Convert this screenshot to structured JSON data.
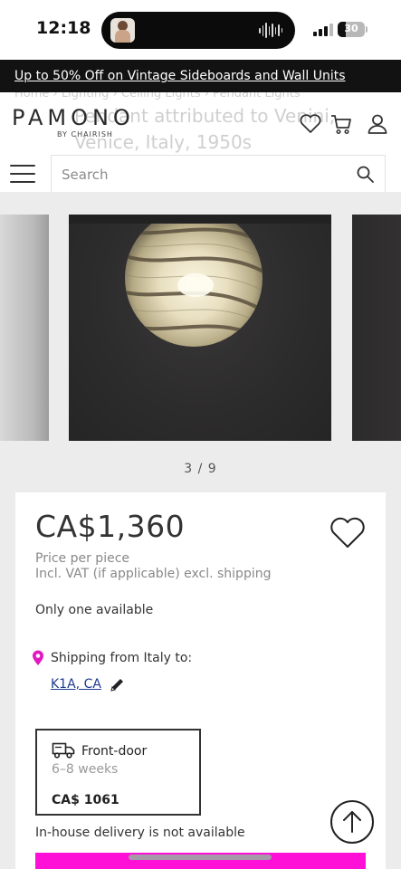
{
  "status_bar": {
    "time": "12:18",
    "battery_percent": "30",
    "battery_level": 0.3,
    "signal_icon": "cellular-signal-icon"
  },
  "promo": {
    "text": "Up to 50% Off on Vintage Sideboards and Wall Units"
  },
  "header": {
    "logo_text": "PAMONO",
    "logo_sub": "BY CHAIRISH",
    "ghost_breadcrumb": "Home › Lighting › Ceiling Lights › Pendant Lights",
    "ghost_title": "Pendant attributed to Venini, Venice, Italy, 1950s",
    "icons": [
      "heart-icon",
      "cart-icon",
      "user-icon"
    ],
    "search_placeholder": "Search"
  },
  "carousel": {
    "current": "3 / 9"
  },
  "product": {
    "price": "CA$1,360",
    "price_note": "Price per piece",
    "vat_note": "Incl. VAT (if applicable) excl. shipping",
    "availability": "Only one available",
    "shipping_from": "Shipping from Italy to:",
    "shipping_postal": "K1A, CA",
    "delivery": {
      "label": "Front-door",
      "weeks": "6–8 weeks",
      "price": "CA$ 1061"
    },
    "inhouse": "In-house delivery is not available"
  },
  "colors": {
    "accent": "#ff10d6",
    "link": "#1f3b8f",
    "banner": "#121212"
  }
}
